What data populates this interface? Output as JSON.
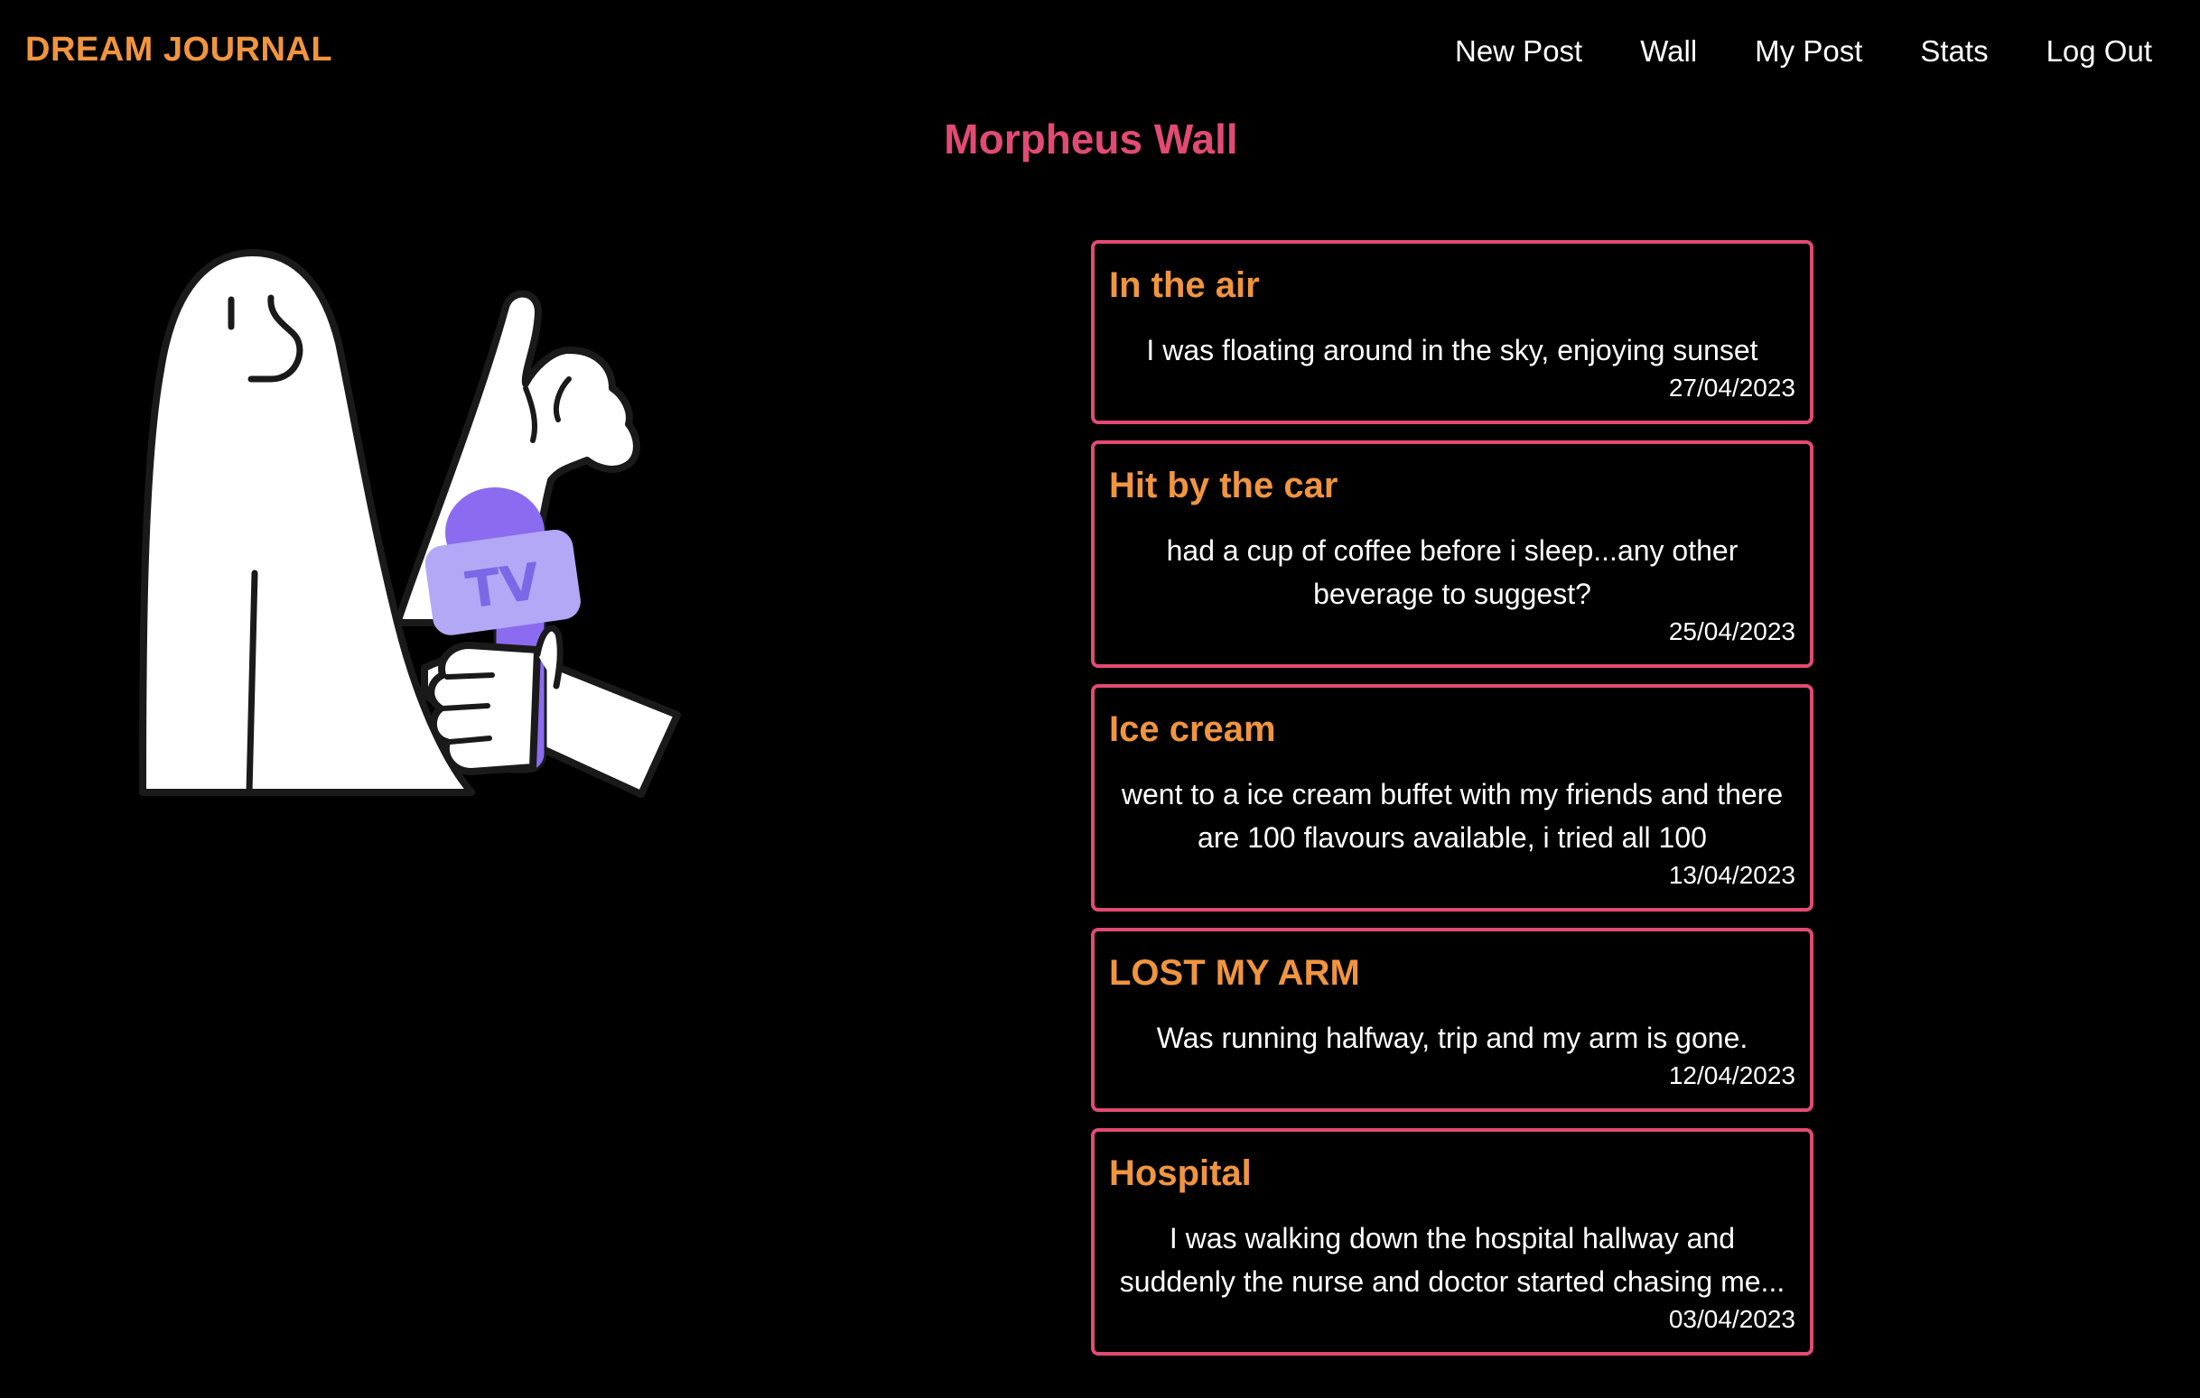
{
  "brand": {
    "title": "DREAM JOURNAL",
    "color": "#f0953f"
  },
  "nav": {
    "items": [
      {
        "label": "New Post"
      },
      {
        "label": "Wall"
      },
      {
        "label": "My Post"
      },
      {
        "label": "Stats"
      },
      {
        "label": "Log Out"
      }
    ]
  },
  "page": {
    "title": "Morpheus Wall",
    "title_color": "#e14b73"
  },
  "illustration": {
    "icon": "ghost-holding-tv-microphone",
    "mic_label": "TV",
    "mic_color": "#8b6cf0"
  },
  "posts": [
    {
      "title": "In the air",
      "body": "I was floating around in the sky, enjoying sunset",
      "date": "27/04/2023"
    },
    {
      "title": "Hit by the car",
      "body": "had a cup of coffee before i sleep...any other beverage to suggest?",
      "date": "25/04/2023"
    },
    {
      "title": "Ice cream",
      "body": "went to a ice cream buffet with my friends and there are 100 flavours available, i tried all 100",
      "date": "13/04/2023"
    },
    {
      "title": "LOST MY ARM",
      "body": "Was running halfway, trip and my arm is gone.",
      "date": "12/04/2023"
    },
    {
      "title": "Hospital",
      "body": "I was walking down the hospital hallway and suddenly the nurse and doctor started chasing me...",
      "date": "03/04/2023"
    }
  ],
  "colors": {
    "background": "#000000",
    "card_border": "#e14b73",
    "post_title": "#f0953f",
    "text": "#ffffff"
  }
}
